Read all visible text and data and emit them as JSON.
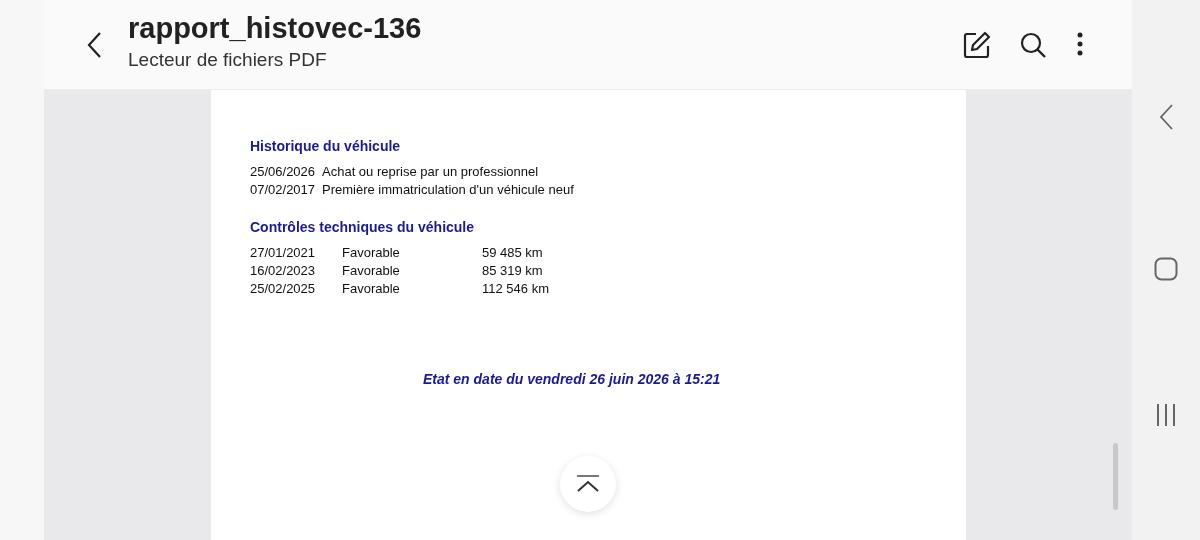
{
  "header": {
    "title": "rapport_histovec-136",
    "subtitle": "Lecteur de fichiers PDF"
  },
  "document": {
    "history": {
      "heading": "Historique du véhicule",
      "rows": [
        {
          "date": "25/06/2026",
          "event": "Achat ou reprise par un professionnel"
        },
        {
          "date": "07/02/2017",
          "event": "Première immatriculation d'un véhicule neuf"
        }
      ]
    },
    "inspections": {
      "heading": "Contrôles techniques du véhicule",
      "rows": [
        {
          "date": "27/01/2021",
          "result": "Favorable",
          "mileage": "59 485 km"
        },
        {
          "date": "16/02/2023",
          "result": "Favorable",
          "mileage": "85 319 km"
        },
        {
          "date": "25/02/2025",
          "result": "Favorable",
          "mileage": "112 546 km"
        }
      ]
    },
    "footer": "Etat en date du vendredi 26 juin 2026 à 15:21"
  }
}
